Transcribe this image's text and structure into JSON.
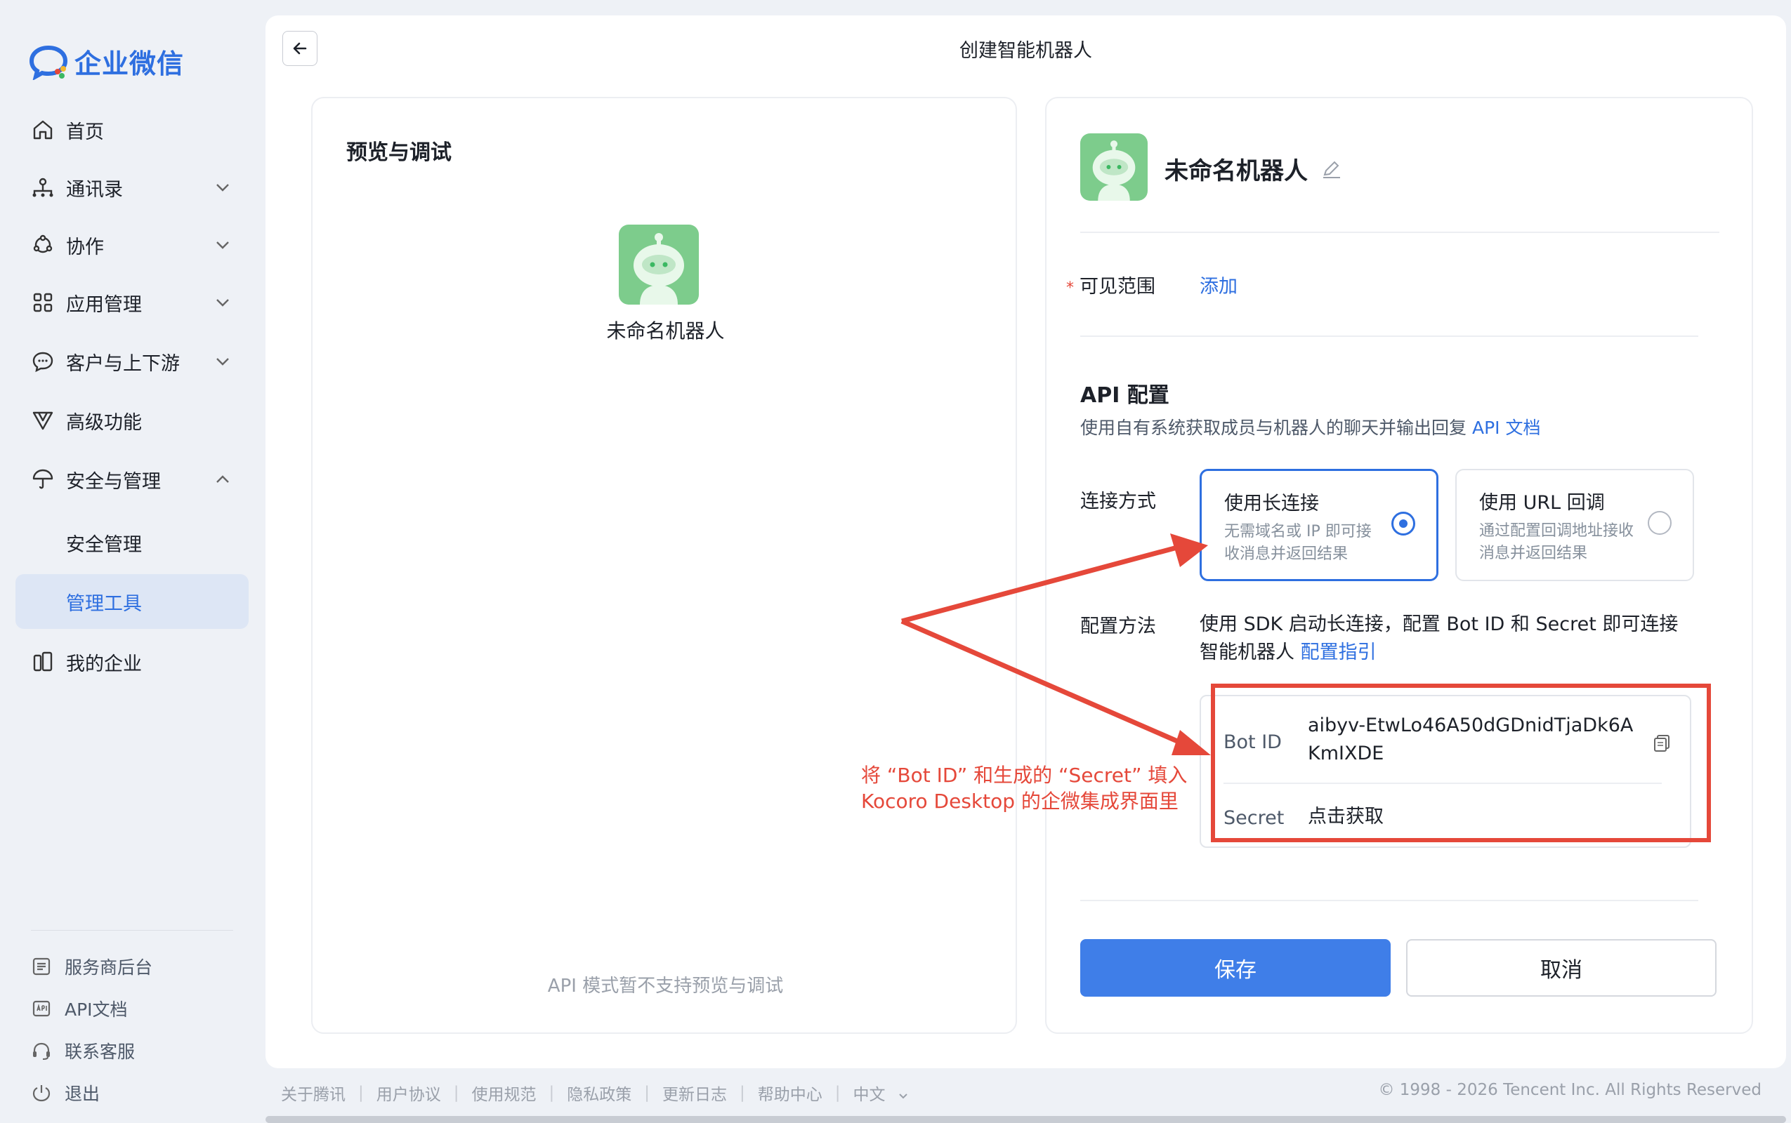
{
  "app": {
    "name": "企业微信"
  },
  "sidebar": {
    "items": [
      {
        "label": "首页",
        "icon": "home-icon"
      },
      {
        "label": "通讯录",
        "icon": "contacts-icon",
        "chevron": "down"
      },
      {
        "label": "协作",
        "icon": "collab-icon",
        "chevron": "down"
      },
      {
        "label": "应用管理",
        "icon": "apps-icon",
        "chevron": "down"
      },
      {
        "label": "客户与上下游",
        "icon": "chat-bubble-icon",
        "chevron": "down"
      },
      {
        "label": "高级功能",
        "icon": "v-icon"
      },
      {
        "label": "安全与管理",
        "icon": "umbrella-icon",
        "chevron": "up"
      },
      {
        "label": "安全管理",
        "sub": true
      },
      {
        "label": "管理工具",
        "sub": true,
        "active": true
      },
      {
        "label": "我的企业",
        "icon": "building-icon"
      }
    ],
    "footer": [
      {
        "label": "服务商后台",
        "icon": "service-icon"
      },
      {
        "label": "API文档",
        "icon": "api-doc-icon"
      },
      {
        "label": "联系客服",
        "icon": "headset-icon"
      },
      {
        "label": "退出",
        "icon": "power-icon"
      }
    ]
  },
  "header": {
    "title": "创建智能机器人"
  },
  "preview": {
    "title": "预览与调试",
    "bot_name": "未命名机器人",
    "note": "API 模式暂不支持预览与调试"
  },
  "config": {
    "bot_name": "未命名机器人",
    "visible_scope": {
      "label": "可见范围",
      "required_mark": "*",
      "add_link": "添加"
    },
    "api": {
      "title": "API 配置",
      "desc": "使用自有系统获取成员与机器人的聊天并输出回复",
      "doc_link": "API 文档"
    },
    "connection": {
      "label": "连接方式",
      "options": [
        {
          "title": "使用长连接",
          "desc": "无需域名或 IP 即可接收消息并返回结果",
          "selected": true
        },
        {
          "title": "使用 URL 回调",
          "desc": "通过配置回调地址接收消息并返回结果",
          "selected": false
        }
      ]
    },
    "method": {
      "label": "配置方法",
      "text": "使用 SDK 启动长连接，配置 Bot ID 和 Secret 即可连接智能机器人",
      "guide_link": "配置指引"
    },
    "credentials": {
      "bot_id_label": "Bot ID",
      "bot_id_value": "aibyv-EtwLo46A50dGDnidTjaDk6AKmIXDE",
      "secret_label": "Secret",
      "secret_link": "点击获取"
    },
    "buttons": {
      "save": "保存",
      "cancel": "取消"
    }
  },
  "annotation": {
    "text": "将 “Bot ID” 和生成的 “Secret” 填入 Kocoro Desktop 的企微集成界面里",
    "color": "#e5483a"
  },
  "footer": {
    "links": [
      "关于腾讯",
      "用户协议",
      "使用规范",
      "隐私政策",
      "更新日志",
      "帮助中心",
      "中文"
    ],
    "copyright": "© 1998 - 2026 Tencent Inc. All Rights Reserved"
  },
  "colors": {
    "accent": "#2e6fe0",
    "primary_button": "#3f7ee8",
    "annotation": "#e5483a",
    "robot_bg": "#7dcc8c"
  }
}
